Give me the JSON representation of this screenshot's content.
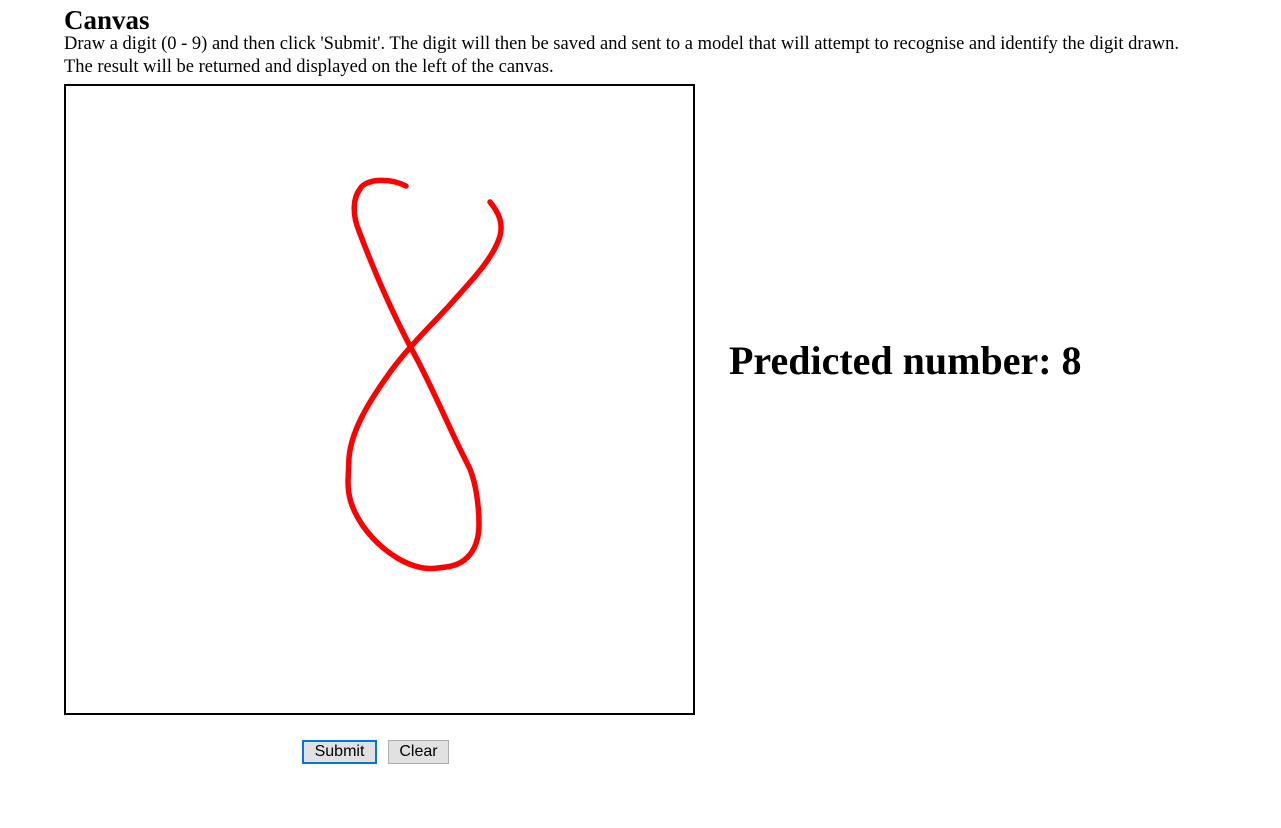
{
  "header": {
    "title": "Canvas",
    "description_line1": "Draw a digit (0 - 9) and then click 'Submit'. The digit will then be saved and sent to a model that will attempt to recognise and identify the digit drawn.",
    "description_line2": "The result will be returned and displayed on the left of the canvas."
  },
  "canvas": {
    "stroke_color": "#ff0000",
    "background_color": "#ffffff",
    "border_color": "#000000"
  },
  "result": {
    "prediction_text": "Predicted number: 8"
  },
  "buttons": {
    "submit_label": "Submit",
    "clear_label": "Clear",
    "submit_focus_color": "#0078d7"
  }
}
